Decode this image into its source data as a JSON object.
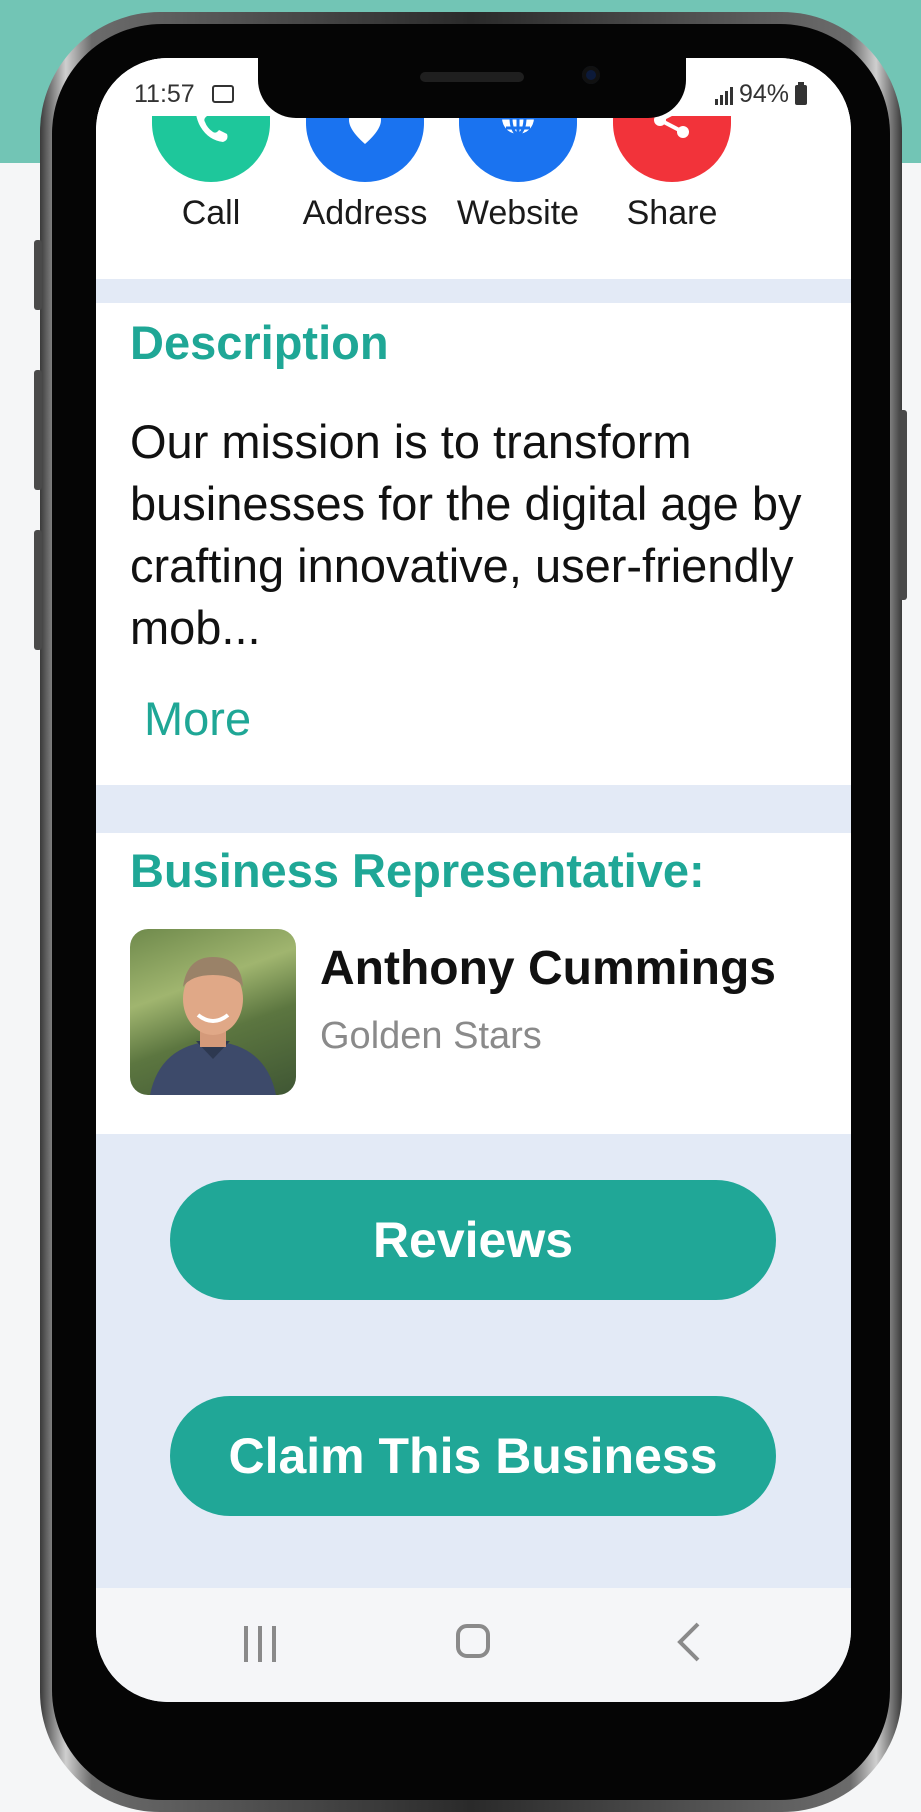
{
  "status_bar": {
    "time": "11:57",
    "battery": "94%"
  },
  "actions": [
    {
      "label": "Call",
      "icon": "phone-icon",
      "color": "#1ec79b"
    },
    {
      "label": "Address",
      "icon": "location-pin-icon",
      "color": "#1a73f0"
    },
    {
      "label": "Website",
      "icon": "globe-icon",
      "color": "#1a73f0"
    },
    {
      "label": "Share",
      "icon": "share-icon",
      "color": "#f2333a"
    }
  ],
  "description": {
    "title": "Description",
    "text": "Our mission is to transform businesses for the digital age by crafting innovative, user-friendly mob...",
    "more_label": "More"
  },
  "representative": {
    "title": "Business Representative:",
    "name": "Anthony Cummings",
    "company": "Golden Stars"
  },
  "buttons": {
    "reviews": "Reviews",
    "claim": "Claim This Business"
  },
  "colors": {
    "accent": "#20a797",
    "page_band": "#72c5b5",
    "section_bg": "#e3eaf6"
  }
}
